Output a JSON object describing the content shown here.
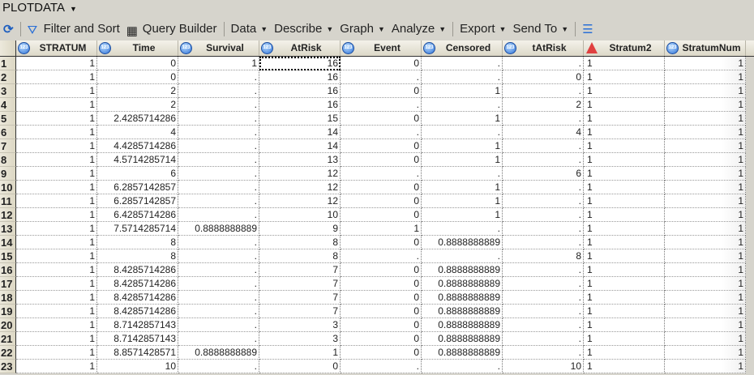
{
  "title": "PLOTDATA",
  "toolbar": {
    "filter_sort": "Filter and Sort",
    "query_builder": "Query Builder",
    "data": "Data",
    "describe": "Describe",
    "graph": "Graph",
    "analyze": "Analyze",
    "export": "Export",
    "send_to": "Send To"
  },
  "columns": [
    {
      "name": "STRATUM",
      "type": "numeric"
    },
    {
      "name": "Time",
      "type": "numeric"
    },
    {
      "name": "Survival",
      "type": "numeric"
    },
    {
      "name": "AtRisk",
      "type": "numeric"
    },
    {
      "name": "Event",
      "type": "numeric"
    },
    {
      "name": "Censored",
      "type": "numeric"
    },
    {
      "name": "tAtRisk",
      "type": "numeric"
    },
    {
      "name": "Stratum2",
      "type": "character"
    },
    {
      "name": "StratumNum",
      "type": "numeric"
    }
  ],
  "rows": [
    [
      "1",
      "0",
      "1",
      "16",
      "0",
      ".",
      ".",
      "1",
      "1"
    ],
    [
      "1",
      "0",
      ".",
      "16",
      ".",
      ".",
      "0",
      "1",
      "1"
    ],
    [
      "1",
      "2",
      ".",
      "16",
      "0",
      "1",
      ".",
      "1",
      "1"
    ],
    [
      "1",
      "2",
      ".",
      "16",
      ".",
      ".",
      "2",
      "1",
      "1"
    ],
    [
      "1",
      "2.4285714286",
      ".",
      "15",
      "0",
      "1",
      ".",
      "1",
      "1"
    ],
    [
      "1",
      "4",
      ".",
      "14",
      ".",
      ".",
      "4",
      "1",
      "1"
    ],
    [
      "1",
      "4.4285714286",
      ".",
      "14",
      "0",
      "1",
      ".",
      "1",
      "1"
    ],
    [
      "1",
      "4.5714285714",
      ".",
      "13",
      "0",
      "1",
      ".",
      "1",
      "1"
    ],
    [
      "1",
      "6",
      ".",
      "12",
      ".",
      ".",
      "6",
      "1",
      "1"
    ],
    [
      "1",
      "6.2857142857",
      ".",
      "12",
      "0",
      "1",
      ".",
      "1",
      "1"
    ],
    [
      "1",
      "6.2857142857",
      ".",
      "12",
      "0",
      "1",
      ".",
      "1",
      "1"
    ],
    [
      "1",
      "6.4285714286",
      ".",
      "10",
      "0",
      "1",
      ".",
      "1",
      "1"
    ],
    [
      "1",
      "7.5714285714",
      "0.8888888889",
      "9",
      "1",
      ".",
      ".",
      "1",
      "1"
    ],
    [
      "1",
      "8",
      ".",
      "8",
      "0",
      "0.8888888889",
      ".",
      "1",
      "1"
    ],
    [
      "1",
      "8",
      ".",
      "8",
      ".",
      ".",
      "8",
      "1",
      "1"
    ],
    [
      "1",
      "8.4285714286",
      ".",
      "7",
      "0",
      "0.8888888889",
      ".",
      "1",
      "1"
    ],
    [
      "1",
      "8.4285714286",
      ".",
      "7",
      "0",
      "0.8888888889",
      ".",
      "1",
      "1"
    ],
    [
      "1",
      "8.4285714286",
      ".",
      "7",
      "0",
      "0.8888888889",
      ".",
      "1",
      "1"
    ],
    [
      "1",
      "8.4285714286",
      ".",
      "7",
      "0",
      "0.8888888889",
      ".",
      "1",
      "1"
    ],
    [
      "1",
      "8.7142857143",
      ".",
      "3",
      "0",
      "0.8888888889",
      ".",
      "1",
      "1"
    ],
    [
      "1",
      "8.7142857143",
      ".",
      "3",
      "0",
      "0.8888888889",
      ".",
      "1",
      "1"
    ],
    [
      "1",
      "8.8571428571",
      "0.8888888889",
      "1",
      "0",
      "0.8888888889",
      ".",
      "1",
      "1"
    ],
    [
      "1",
      "10",
      ".",
      "0",
      ".",
      ".",
      "10",
      "1",
      "1"
    ]
  ]
}
